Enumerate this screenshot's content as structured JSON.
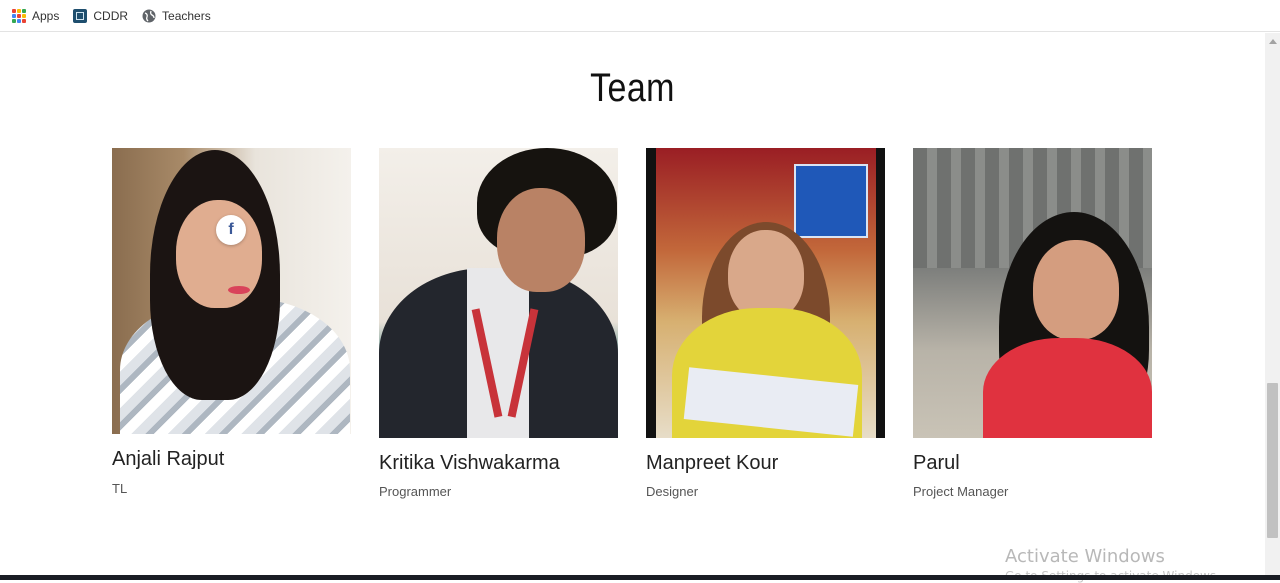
{
  "bookmarks": {
    "items": [
      {
        "label": "Apps",
        "icon": "apps-grid-icon"
      },
      {
        "label": "CDDR",
        "icon": "cddr-favicon-icon"
      },
      {
        "label": "Teachers",
        "icon": "globe-icon"
      }
    ]
  },
  "section": {
    "title": "Team"
  },
  "team": [
    {
      "name": "Anjali Rajput",
      "role": "TL",
      "social": "f"
    },
    {
      "name": "Kritika Vishwakarma",
      "role": "Programmer"
    },
    {
      "name": "Manpreet Kour",
      "role": "Designer"
    },
    {
      "name": "Parul",
      "role": "Project Manager"
    }
  ],
  "watermark": {
    "title": "Activate Windows",
    "subtitle": "Go to Settings to activate Windows."
  },
  "colors": {
    "facebook": "#3b5998",
    "accent_dark": "#1a1d24"
  }
}
